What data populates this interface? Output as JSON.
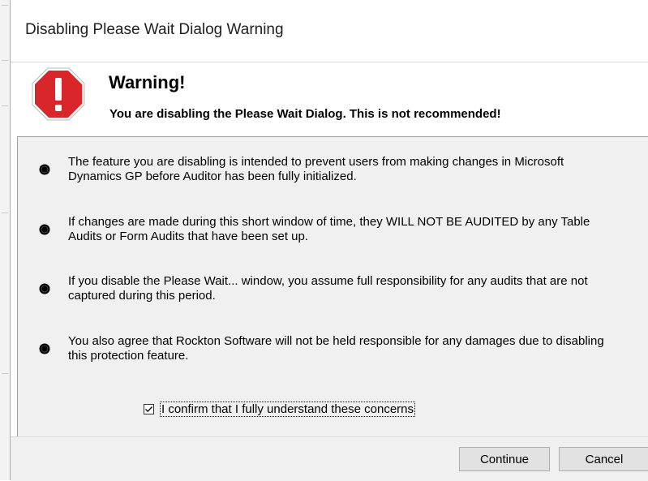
{
  "window": {
    "title": "Disabling Please Wait Dialog Warning"
  },
  "header": {
    "icon": "warning-stop-icon",
    "title": "Warning!",
    "subtitle": "You are disabling the Please Wait Dialog. This is not recommended!"
  },
  "bullets": [
    {
      "icon": "bullet-dot-icon",
      "text": "The feature you are disabling is intended to prevent users from making changes in Microsoft Dynamics GP before Auditor has been fully initialized."
    },
    {
      "icon": "bullet-dot-icon",
      "text": "If changes are made during this short window of time, they WILL NOT BE AUDITED by any Table Audits or Form Audits that have been set up."
    },
    {
      "icon": "bullet-dot-icon",
      "text": "If you disable the Please Wait... window, you assume full responsibility for any audits that are not captured during this period."
    },
    {
      "icon": "bullet-dot-icon",
      "text": "You also agree that Rockton Software will not be held responsible for any damages due to disabling this protection feature."
    }
  ],
  "confirm": {
    "checked": true,
    "label": "I confirm that I fully understand these concerns"
  },
  "buttons": {
    "continue_label": "Continue",
    "cancel_label": "Cancel"
  },
  "colors": {
    "warning_red": "#d9262b",
    "dialog_gray": "#f0f0f0"
  }
}
